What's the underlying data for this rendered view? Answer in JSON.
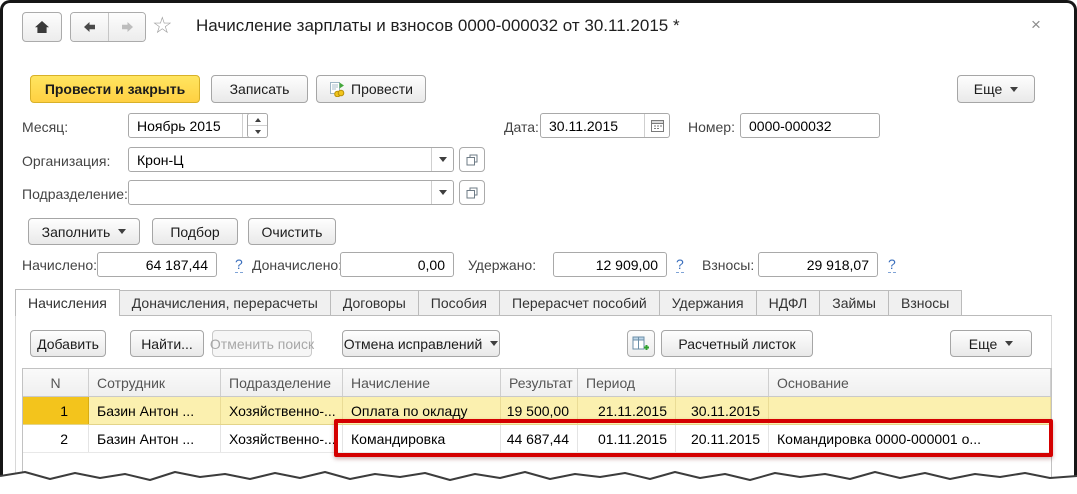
{
  "header": {
    "title": "Начисление зарплаты и взносов 0000-000032 от 30.11.2015 *",
    "close": "×"
  },
  "command_bar": {
    "post_and_close": "Провести и закрыть",
    "save": "Записать",
    "post": "Провести",
    "more": "Еще"
  },
  "form": {
    "month": {
      "label": "Месяц:",
      "value": "Ноябрь 2015"
    },
    "date": {
      "label": "Дата:",
      "value": "30.11.2015"
    },
    "number": {
      "label": "Номер:",
      "value": "0000-000032"
    },
    "organization": {
      "label": "Организация:",
      "value": "Крон-Ц"
    },
    "department": {
      "label": "Подразделение:",
      "value": ""
    },
    "fill": "Заполнить",
    "pick": "Подбор",
    "clear": "Очистить"
  },
  "totals": {
    "accrued": {
      "label": "Начислено:",
      "value": "64 187,44",
      "help": "?"
    },
    "additional": {
      "label": "Доначислено:",
      "value": "0,00"
    },
    "withheld": {
      "label": "Удержано:",
      "value": "12 909,00",
      "help": "?"
    },
    "contributions": {
      "label": "Взносы:",
      "value": "29 918,07",
      "help": "?"
    }
  },
  "tabs": [
    {
      "label": "Начисления"
    },
    {
      "label": "Доначисления, перерасчеты"
    },
    {
      "label": "Договоры"
    },
    {
      "label": "Пособия"
    },
    {
      "label": "Перерасчет пособий"
    },
    {
      "label": "Удержания"
    },
    {
      "label": "НДФЛ"
    },
    {
      "label": "Займы"
    },
    {
      "label": "Взносы"
    }
  ],
  "grid_toolbar": {
    "add": "Добавить",
    "find": "Найти...",
    "cancel_search": "Отменить поиск",
    "cancel_corrections": "Отмена исправлений",
    "payslip": "Расчетный листок",
    "more": "Еще"
  },
  "table": {
    "columns": [
      "N",
      "Сотрудник",
      "Подразделение",
      "Начисление",
      "Результат",
      "Период",
      "",
      "Основание"
    ],
    "rows": [
      {
        "n": "1",
        "employee": "Базин Антон ...",
        "department": "Хозяйственно-...",
        "accrual": "Оплата по окладу",
        "result": "19 500,00",
        "period_start": "21.11.2015",
        "period_end": "30.11.2015",
        "basis": ""
      },
      {
        "n": "2",
        "employee": "Базин Антон ...",
        "department": "Хозяйственно-...",
        "accrual": "Командировка",
        "result": "44 687,44",
        "period_start": "01.11.2015",
        "period_end": "20.11.2015",
        "basis": "Командировка 0000-000001 о..."
      }
    ]
  },
  "colors": {
    "accent_yellow": "#FFD042",
    "selected_row": "#FBF0AF",
    "row_marker": "#F3C41C",
    "highlight_red": "#D40000",
    "link_blue": "#3B6FBD"
  }
}
